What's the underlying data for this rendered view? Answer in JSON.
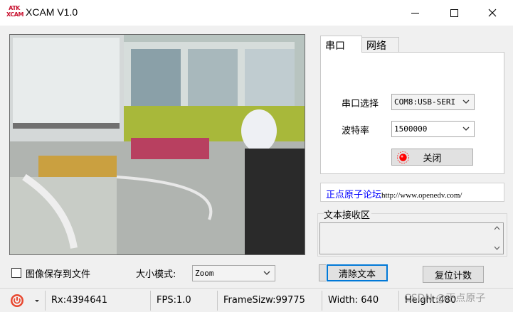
{
  "window": {
    "title": "XCAM V1.0",
    "logo_line1": "ATK",
    "logo_line2": "XCAM"
  },
  "tabs": [
    {
      "label": "串口",
      "selected": true
    },
    {
      "label": "网络",
      "selected": false
    }
  ],
  "serial": {
    "port_label": "串口选择",
    "port_value": "COM8:USB-SERI",
    "baud_label": "波特率",
    "baud_value": "1500000",
    "close_button": "关闭",
    "led_color": "#ff0000"
  },
  "forum": {
    "name": "正点原子论坛",
    "url": "http://www.openedv.com/",
    "color": "#0000ff"
  },
  "receive": {
    "group_label": "文本接收区",
    "text": ""
  },
  "controls": {
    "save_label": "图像保存到文件",
    "save_checked": false,
    "size_label": "大小模式:",
    "size_value": "Zoom",
    "clear_button": "清除文本",
    "reset_button": "复位计数"
  },
  "status": {
    "rx": "Rx:4394641",
    "fps": "FPS:1.0",
    "frame_size": "FrameSizw:99775",
    "width": "Width: 640",
    "height": "Height:480"
  },
  "watermark": "CSDN @正点原子"
}
